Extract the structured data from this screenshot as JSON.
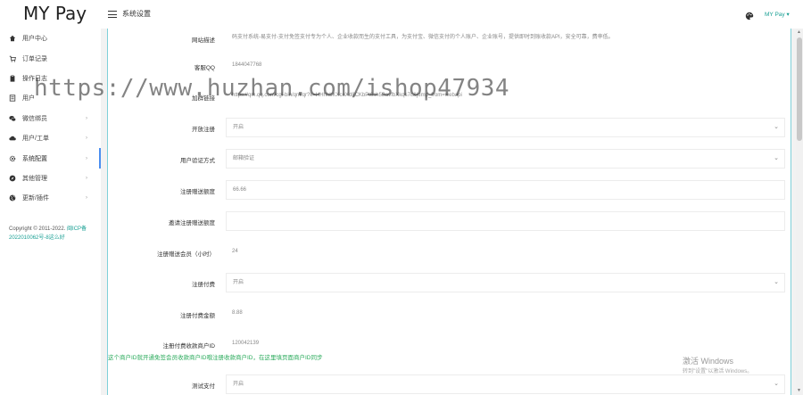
{
  "brand": "MY Pay",
  "header": {
    "title": "系统设置",
    "user": "MY Pay"
  },
  "sidebar": {
    "items": [
      {
        "label": "用户中心",
        "icon": "home-icon",
        "chevron": ""
      },
      {
        "label": "订单记录",
        "icon": "cart-icon",
        "chevron": ""
      },
      {
        "label": "操作日志",
        "icon": "clipboard-icon",
        "chevron": ""
      },
      {
        "label": "用户",
        "icon": "document-icon",
        "chevron": ""
      },
      {
        "label": "微信绑员",
        "icon": "wechat-icon",
        "chevron": "›"
      },
      {
        "label": "用户/工单",
        "icon": "cloud-icon",
        "chevron": "›"
      },
      {
        "label": "系统配置",
        "icon": "gear-icon",
        "chevron": "›"
      },
      {
        "label": "其他管理",
        "icon": "compass-icon",
        "chevron": "›"
      },
      {
        "label": "更新/插件",
        "icon": "globe-icon",
        "chevron": "›"
      }
    ],
    "copyright_prefix": "Copyright © 2011-2022.",
    "copyright_link": "闽ICP备2022010062号-8这么好"
  },
  "form": {
    "rows": [
      {
        "label": "网站描述",
        "value": "码支付系统-易支付-支付免签支付专为个人、企业收款而生的支付工具，为支付宝、微信支付的个人账户、企业账号，提供即时到账收款API，安全可靠，费率低。",
        "type": "plain"
      },
      {
        "label": "客服QQ",
        "value": "1844047768",
        "type": "plain"
      },
      {
        "label": "加群链接",
        "value": "https://qm.qq.com/cgi-bin/qm/qr?k=HHhhbKXcuXd8CKbPt6sh5BavfbXkqs7c&jump_from=webapi",
        "type": "plain"
      },
      {
        "label": "开放注册",
        "value": "开启",
        "type": "select"
      },
      {
        "label": "用户验证方式",
        "value": "邮箱验证",
        "type": "select"
      },
      {
        "label": "注册赠送额度",
        "value": "66.66",
        "type": "input"
      },
      {
        "label": "邀请注册赠送额度",
        "value": "",
        "type": "input"
      },
      {
        "label": "注册赠送会员（小时）",
        "value": "24",
        "type": "plain"
      },
      {
        "label": "注册付费",
        "value": "开启",
        "type": "select"
      },
      {
        "label": "注册付费金额",
        "value": "8.88",
        "type": "plain"
      },
      {
        "label": "注册付费收款商户ID",
        "value": "120042139",
        "type": "plain"
      },
      {
        "label": "测试支付",
        "value": "开启",
        "type": "select"
      }
    ],
    "tip": "这个商户ID就开通免签会员收款商户ID哦注册收款商户ID，在这里填页面商户ID同步"
  },
  "watermark": "https://www.huzhan.com/ishop47934",
  "windows": {
    "title": "激活 Windows",
    "subtitle": "转到\"设置\"以激活 Windows。"
  }
}
